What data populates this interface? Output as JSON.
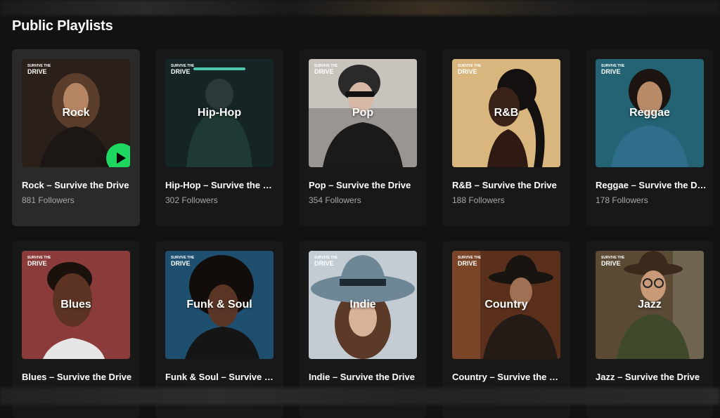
{
  "section": {
    "title": "Public Playlists"
  },
  "brand": {
    "top": "SURVIVE THE",
    "bottom": "DRIVE"
  },
  "playlists": [
    {
      "genre": "Rock",
      "title": "Rock – Survive the Drive",
      "followers": "881 Followers",
      "bg": "#3b2a22"
    },
    {
      "genre": "Hip-Hop",
      "title": "Hip-Hop – Survive the Drive",
      "followers": "302 Followers",
      "bg": "#1d3131"
    },
    {
      "genre": "Pop",
      "title": "Pop – Survive the Drive",
      "followers": "354 Followers",
      "bg": "#8f8a86"
    },
    {
      "genre": "R&B",
      "title": "R&B – Survive the Drive",
      "followers": "188 Followers",
      "bg": "#d6b278"
    },
    {
      "genre": "Reggae",
      "title": "Reggae – Survive the Drive",
      "followers": "178 Followers",
      "bg": "#2c6a78"
    },
    {
      "genre": "Blues",
      "title": "Blues – Survive the Drive",
      "followers": "",
      "bg": "#8c3f3f"
    },
    {
      "genre": "Funk & Soul",
      "title": "Funk & Soul – Survive the Drive",
      "followers": "",
      "bg": "#245a78"
    },
    {
      "genre": "Indie",
      "title": "Indie – Survive the Drive",
      "followers": "",
      "bg": "#b9c3cc"
    },
    {
      "genre": "Country",
      "title": "Country – Survive the Drive",
      "followers": "",
      "bg": "#6b3a24"
    },
    {
      "genre": "Jazz",
      "title": "Jazz – Survive the Drive",
      "followers": "",
      "bg": "#5a4a32"
    }
  ],
  "colors": {
    "accent": "#1ed760",
    "card": "#181818",
    "card_hover": "#2a2a2a"
  }
}
